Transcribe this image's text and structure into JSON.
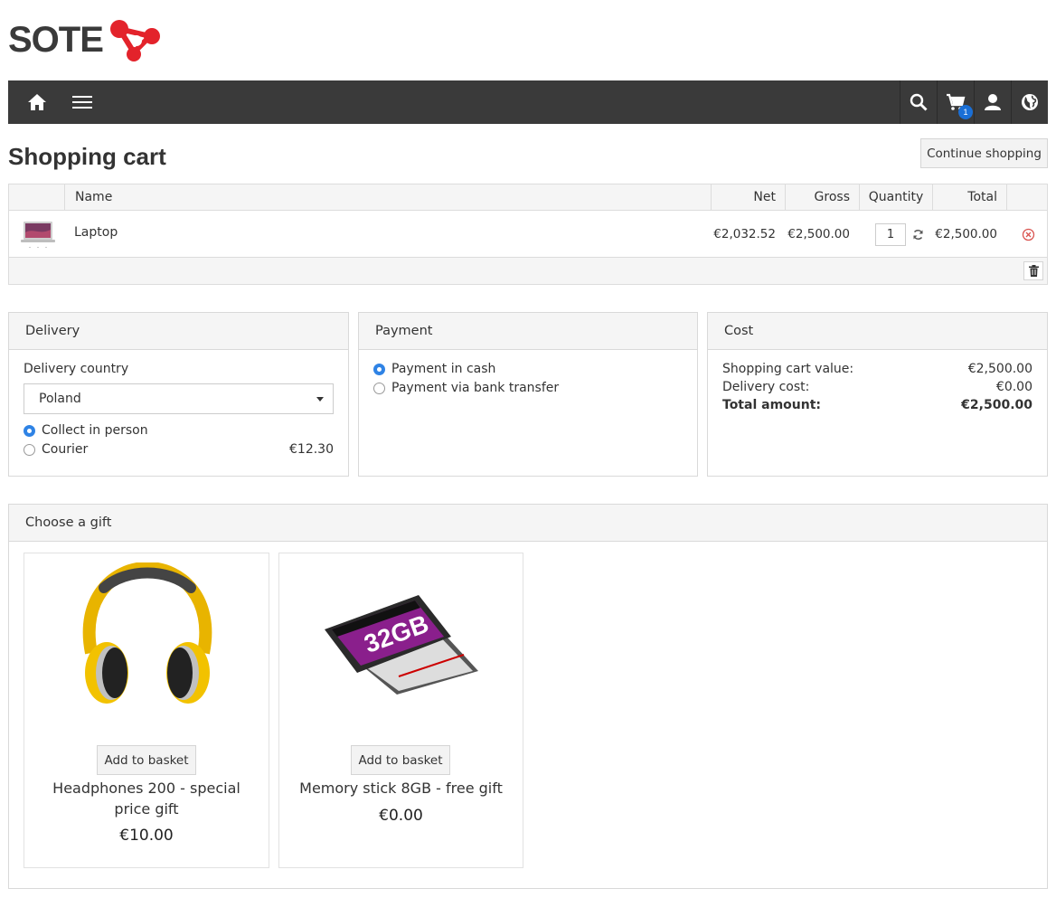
{
  "brand": {
    "name": "SOTE",
    "accent": "#e3232b"
  },
  "nav": {
    "cart_count": "1",
    "icons": [
      "home-icon",
      "menu-icon",
      "search-icon",
      "cart-icon",
      "user-icon",
      "globe-icon"
    ],
    "bar_color": "#3a3a3a"
  },
  "page": {
    "title": "Shopping cart",
    "continue_label": "Continue shopping"
  },
  "cart": {
    "headers": {
      "name": "Name",
      "net": "Net",
      "gross": "Gross",
      "quantity": "Quantity",
      "total": "Total"
    },
    "items": [
      {
        "name": "Laptop",
        "net": "€2,032.52",
        "gross": "€2,500.00",
        "quantity": "1",
        "total": "€2,500.00"
      }
    ]
  },
  "delivery": {
    "title": "Delivery",
    "country_label": "Delivery country",
    "country": "Poland",
    "options": [
      {
        "label": "Collect in person",
        "price": "",
        "selected": true
      },
      {
        "label": "Courier",
        "price": "€12.30",
        "selected": false
      }
    ]
  },
  "payment": {
    "title": "Payment",
    "options": [
      {
        "label": "Payment in cash",
        "selected": true
      },
      {
        "label": "Payment via bank transfer",
        "selected": false
      }
    ]
  },
  "cost": {
    "title": "Cost",
    "cart_value_label": "Shopping cart value:",
    "cart_value": "€2,500.00",
    "delivery_label": "Delivery cost:",
    "delivery": "€0.00",
    "total_label": "Total amount:",
    "total": "€2,500.00"
  },
  "gifts": {
    "title": "Choose a gift",
    "add_label": "Add to basket",
    "items": [
      {
        "name": "Headphones 200 - special price gift",
        "price": "€10.00"
      },
      {
        "name": "Memory stick 8GB - free gift",
        "price": "€0.00",
        "card_text": "32GB"
      }
    ]
  }
}
